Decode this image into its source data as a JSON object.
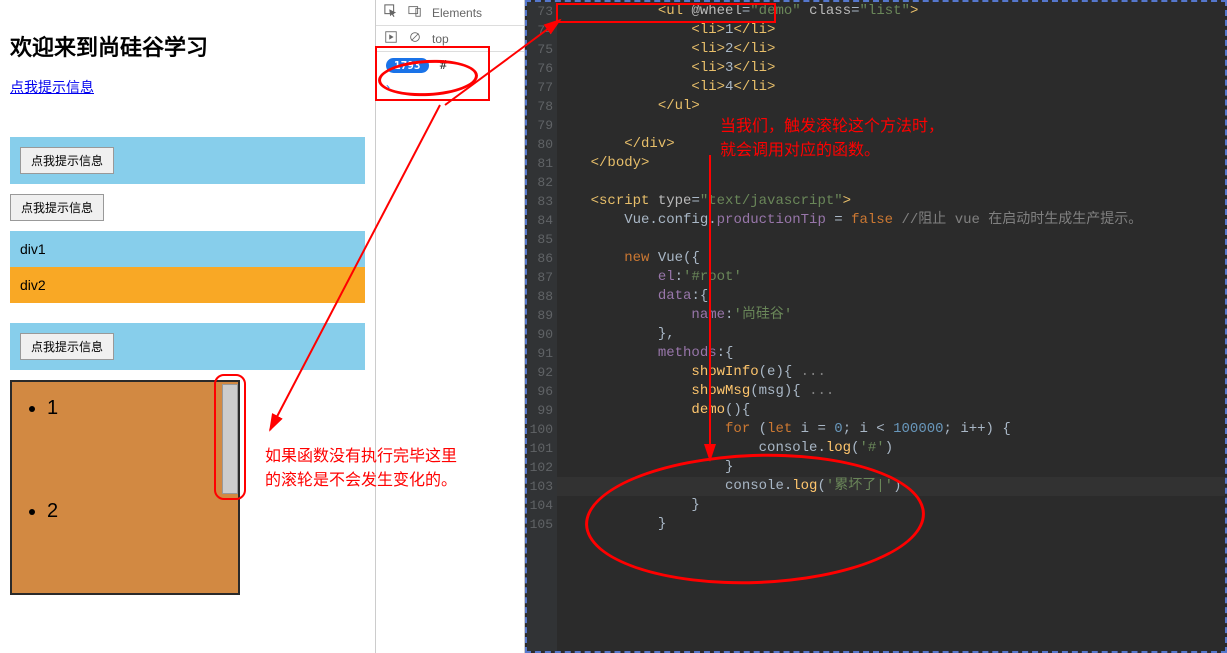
{
  "page": {
    "title": "欢迎来到尚硅谷学习",
    "link_text": "点我提示信息",
    "btn1": "点我提示信息",
    "btn2": "点我提示信息",
    "btn3": "点我提示信息",
    "div1": "div1",
    "div2": "div2",
    "list_items": [
      "1",
      "2"
    ]
  },
  "devtools": {
    "tab_elements": "Elements",
    "filter_top": "top",
    "count": "1793",
    "hash": "#"
  },
  "editor": {
    "line_start": 73,
    "lines": {
      "73": {
        "indent": 3,
        "tokens": [
          {
            "c": "tag",
            "t": "<ul"
          },
          {
            "c": "attr",
            "t": " @wheel"
          },
          {
            "c": "txt",
            "t": "="
          },
          {
            "c": "str",
            "t": "\"demo\""
          },
          {
            "c": "attr",
            "t": " class"
          },
          {
            "c": "txt",
            "t": "="
          },
          {
            "c": "str",
            "t": "\"list\""
          },
          {
            "c": "tag",
            "t": ">"
          }
        ]
      },
      "74": {
        "indent": 4,
        "tokens": [
          {
            "c": "tag",
            "t": "<li>"
          },
          {
            "c": "txt",
            "t": "1"
          },
          {
            "c": "tag",
            "t": "</li>"
          }
        ]
      },
      "75": {
        "indent": 4,
        "tokens": [
          {
            "c": "tag",
            "t": "<li>"
          },
          {
            "c": "txt",
            "t": "2"
          },
          {
            "c": "tag",
            "t": "</li>"
          }
        ]
      },
      "76": {
        "indent": 4,
        "tokens": [
          {
            "c": "tag",
            "t": "<li>"
          },
          {
            "c": "txt",
            "t": "3"
          },
          {
            "c": "tag",
            "t": "</li>"
          }
        ]
      },
      "77": {
        "indent": 4,
        "tokens": [
          {
            "c": "tag",
            "t": "<li>"
          },
          {
            "c": "txt",
            "t": "4"
          },
          {
            "c": "tag",
            "t": "</li>"
          }
        ]
      },
      "78": {
        "indent": 3,
        "tokens": [
          {
            "c": "tag",
            "t": "</ul>"
          }
        ]
      },
      "79": {
        "indent": 0,
        "tokens": []
      },
      "80": {
        "indent": 2,
        "tokens": [
          {
            "c": "tag",
            "t": "</div>"
          }
        ]
      },
      "81": {
        "indent": 1,
        "tokens": [
          {
            "c": "tag",
            "t": "</body>"
          }
        ]
      },
      "82": {
        "indent": 0,
        "tokens": []
      },
      "83": {
        "indent": 1,
        "tokens": [
          {
            "c": "tag",
            "t": "<script"
          },
          {
            "c": "attr",
            "t": " type"
          },
          {
            "c": "txt",
            "t": "="
          },
          {
            "c": "str",
            "t": "\"text/javascript\""
          },
          {
            "c": "tag",
            "t": ">"
          }
        ]
      },
      "84": {
        "indent": 2,
        "tokens": [
          {
            "c": "txt",
            "t": "Vue.config."
          },
          {
            "c": "prop",
            "t": "productionTip"
          },
          {
            "c": "txt",
            "t": " = "
          },
          {
            "c": "kw",
            "t": "false"
          },
          {
            "c": "txt",
            "t": " "
          },
          {
            "c": "cmt",
            "t": "//阻止 vue 在启动时生成生产提示。"
          }
        ]
      },
      "85": {
        "indent": 0,
        "tokens": []
      },
      "86": {
        "indent": 2,
        "tokens": [
          {
            "c": "kw",
            "t": "new"
          },
          {
            "c": "txt",
            "t": " Vue({"
          }
        ]
      },
      "87": {
        "indent": 3,
        "tokens": [
          {
            "c": "prop",
            "t": "el"
          },
          {
            "c": "txt",
            "t": ":"
          },
          {
            "c": "str",
            "t": "'#root'"
          }
        ]
      },
      "88": {
        "indent": 3,
        "tokens": [
          {
            "c": "prop",
            "t": "data"
          },
          {
            "c": "txt",
            "t": ":{"
          }
        ]
      },
      "89": {
        "indent": 4,
        "tokens": [
          {
            "c": "prop",
            "t": "name"
          },
          {
            "c": "txt",
            "t": ":"
          },
          {
            "c": "str",
            "t": "'尚硅谷'"
          }
        ]
      },
      "90": {
        "indent": 3,
        "tokens": [
          {
            "c": "txt",
            "t": "},"
          }
        ]
      },
      "91": {
        "indent": 3,
        "tokens": [
          {
            "c": "prop",
            "t": "methods"
          },
          {
            "c": "txt",
            "t": ":{"
          }
        ]
      },
      "92": {
        "indent": 4,
        "tokens": [
          {
            "c": "fn",
            "t": "showInfo"
          },
          {
            "c": "txt",
            "t": "(e){"
          },
          {
            "c": "cmt",
            "t": " ..."
          }
        ]
      },
      "96": {
        "indent": 4,
        "tokens": [
          {
            "c": "fn",
            "t": "showMsg"
          },
          {
            "c": "txt",
            "t": "("
          },
          {
            "c": "txt",
            "t": "msg"
          },
          {
            "c": "txt",
            "t": "){"
          },
          {
            "c": "cmt",
            "t": " ..."
          }
        ]
      },
      "99": {
        "indent": 4,
        "tokens": [
          {
            "c": "fn",
            "t": "demo"
          },
          {
            "c": "txt",
            "t": "(){"
          }
        ]
      },
      "100": {
        "indent": 5,
        "tokens": [
          {
            "c": "kw",
            "t": "for"
          },
          {
            "c": "txt",
            "t": " ("
          },
          {
            "c": "kw",
            "t": "let"
          },
          {
            "c": "txt",
            "t": " i = "
          },
          {
            "c": "num",
            "t": "0"
          },
          {
            "c": "txt",
            "t": "; i < "
          },
          {
            "c": "num",
            "t": "100000"
          },
          {
            "c": "txt",
            "t": "; i++) {"
          }
        ]
      },
      "101": {
        "indent": 6,
        "tokens": [
          {
            "c": "txt",
            "t": "console."
          },
          {
            "c": "fn",
            "t": "log"
          },
          {
            "c": "txt",
            "t": "("
          },
          {
            "c": "str",
            "t": "'#'"
          },
          {
            "c": "txt",
            "t": ")"
          }
        ]
      },
      "102": {
        "indent": 5,
        "tokens": [
          {
            "c": "txt",
            "t": "}"
          }
        ]
      },
      "103": {
        "indent": 5,
        "tokens": [
          {
            "c": "txt",
            "t": "console."
          },
          {
            "c": "fn",
            "t": "log"
          },
          {
            "c": "txt",
            "t": "("
          },
          {
            "c": "str",
            "t": "'累坏了|'"
          },
          {
            "c": "txt",
            "t": ")"
          }
        ]
      },
      "104": {
        "indent": 4,
        "tokens": [
          {
            "c": "txt",
            "t": "}"
          }
        ]
      },
      "105": {
        "indent": 3,
        "tokens": [
          {
            "c": "txt",
            "t": "}"
          }
        ]
      }
    },
    "line_order": [
      "73",
      "74",
      "75",
      "76",
      "77",
      "78",
      "79",
      "80",
      "81",
      "82",
      "83",
      "84",
      "85",
      "86",
      "87",
      "88",
      "89",
      "90",
      "91",
      "92",
      "96",
      "99",
      "100",
      "101",
      "102",
      "103",
      "104",
      "105"
    ]
  },
  "annotations": {
    "a1_line1": "当我们，触发滚轮这个方法时，",
    "a1_line2": "就会调用对应的函数。",
    "a2_line1": "如果函数没有执行完毕这里",
    "a2_line2": "的滚轮是不会发生变化的。"
  }
}
